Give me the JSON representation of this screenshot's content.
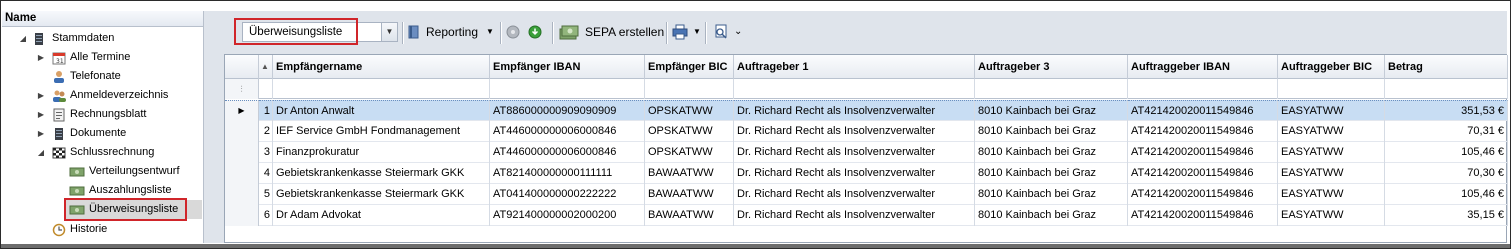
{
  "tree": {
    "header": "Name",
    "items": [
      {
        "label": "Stammdaten",
        "icon": "server-icon",
        "expander": "open"
      },
      {
        "label": "Alle Termine",
        "icon": "calendar-icon",
        "expander": "closed"
      },
      {
        "label": "Telefonate",
        "icon": "user-phone-icon",
        "expander": ""
      },
      {
        "label": "Anmeldeverzeichnis",
        "icon": "users-icon",
        "expander": "closed"
      },
      {
        "label": "Rechnungsblatt",
        "icon": "document-icon",
        "expander": "closed"
      },
      {
        "label": "Dokumente",
        "icon": "server-icon",
        "expander": "closed"
      },
      {
        "label": "Schlussrechnung",
        "icon": "checkered-flag-icon",
        "expander": "open"
      },
      {
        "label": "Verteilungsentwurf",
        "icon": "money-icon",
        "expander": ""
      },
      {
        "label": "Auszahlungsliste",
        "icon": "money-icon",
        "expander": ""
      },
      {
        "label": "Überweisungsliste",
        "icon": "money-icon",
        "expander": ""
      },
      {
        "label": "Historie",
        "icon": "history-icon",
        "expander": ""
      }
    ]
  },
  "toolbar": {
    "combo_value": "Überweisungsliste",
    "reporting_label": "Reporting",
    "sepa_label": "SEPA erstellen"
  },
  "grid": {
    "columns": [
      "Empfängername",
      "Empfänger IBAN",
      "Empfänger BIC",
      "Auftrageber 1",
      "Auftrageber 3",
      "Auftraggeber IBAN",
      "Auftraggeber BIC",
      "Betrag"
    ],
    "rows": [
      [
        "1",
        "Dr Anton Anwalt",
        "AT886000000909090909",
        "OPSKATWW",
        "Dr. Richard Recht als Insolvenzverwalter",
        "8010 Kainbach bei Graz",
        "AT421420020011549846",
        "EASYATWW",
        "351,53 €"
      ],
      [
        "2",
        "IEF Service GmbH Fondmanagement",
        "AT446000000006000846",
        "OPSKATWW",
        "Dr. Richard Recht als Insolvenzverwalter",
        "8010 Kainbach bei Graz",
        "AT421420020011549846",
        "EASYATWW",
        "70,31 €"
      ],
      [
        "3",
        "Finanzprokuratur",
        "AT446000000006000846",
        "OPSKATWW",
        "Dr. Richard Recht als Insolvenzverwalter",
        "8010 Kainbach bei Graz",
        "AT421420020011549846",
        "EASYATWW",
        "105,46 €"
      ],
      [
        "4",
        "Gebietskrankenkasse Steiermark GKK",
        "AT821400000000111111",
        "BAWAATWW",
        "Dr. Richard Recht als Insolvenzverwalter",
        "8010 Kainbach bei Graz",
        "AT421420020011549846",
        "EASYATWW",
        "70,30 €"
      ],
      [
        "5",
        "Gebietskrankenkasse Steiermark GKK",
        "AT041400000000222222",
        "BAWAATWW",
        "Dr. Richard Recht als Insolvenzverwalter",
        "8010 Kainbach bei Graz",
        "AT421420020011549846",
        "EASYATWW",
        "105,46 €"
      ],
      [
        "6",
        "Dr Adam Advokat",
        "AT921400000002000200",
        "BAWAATWW",
        "Dr. Richard Recht als Insolvenzverwalter",
        "8010 Kainbach bei Graz",
        "AT421420020011549846",
        "EASYATWW",
        "35,15 €"
      ]
    ],
    "selected_row": 0
  },
  "colors": {
    "highlight": "#d0252a",
    "selection": "#c8ddf3",
    "panel_bg": "#dfe4eb"
  }
}
